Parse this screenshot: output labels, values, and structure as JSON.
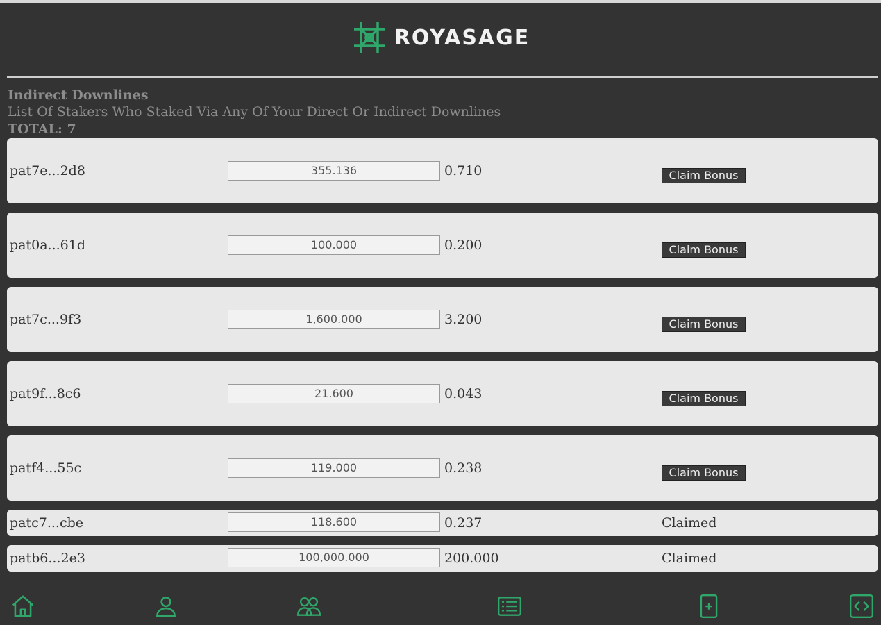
{
  "brand": {
    "name": "ROYASAGE",
    "accent": "#2fa76a"
  },
  "section": {
    "title": "Indirect Downlines",
    "subtitle": "List Of Stakers Who Staked Via Any Of Your Direct Or Indirect Downlines",
    "total": "TOTAL: 7"
  },
  "rows": [
    {
      "address": "pat7e...2d8",
      "amount": "355.136",
      "bonus": "0.710",
      "action": "Claim Bonus"
    },
    {
      "address": "pat0a...61d",
      "amount": "100.000",
      "bonus": "0.200",
      "action": "Claim Bonus"
    },
    {
      "address": "pat7c...9f3",
      "amount": "1,600.000",
      "bonus": "3.200",
      "action": "Claim Bonus"
    },
    {
      "address": "pat9f...8c6",
      "amount": "21.600",
      "bonus": "0.043",
      "action": "Claim Bonus"
    },
    {
      "address": "patf4...55c",
      "amount": "119.000",
      "bonus": "0.238",
      "action": "Claim Bonus"
    },
    {
      "address": "patc7...cbe",
      "amount": "118.600",
      "bonus": "0.237",
      "status": "Claimed"
    },
    {
      "address": "patb6...2e3",
      "amount": "100,000.000",
      "bonus": "200.000",
      "status": "Claimed"
    }
  ],
  "nav": {
    "icons": [
      "home-icon",
      "user-icon",
      "users-icon",
      "list-icon",
      "add-document-icon",
      "code-icon"
    ],
    "color": "#2fa76a"
  }
}
